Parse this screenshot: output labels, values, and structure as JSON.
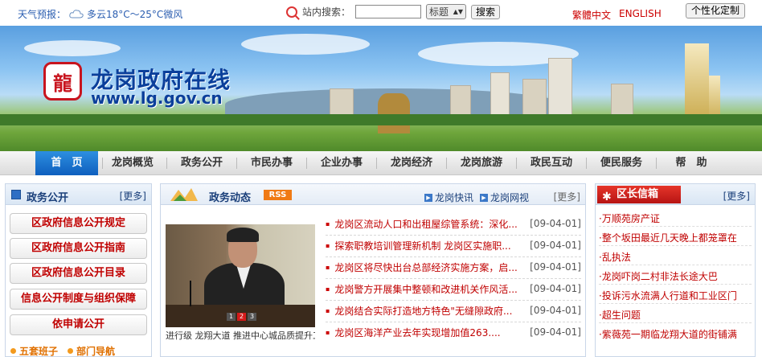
{
  "topbar": {
    "weather_label": "天气预报：",
    "weather_value": "多云18°C～25°C微风",
    "search_label": "站内搜索：",
    "search_value": "",
    "search_scope": "标题",
    "search_button": "搜索",
    "lang_traditional": "繁體中文",
    "lang_english": "ENGLISH",
    "customize_button": "个性化定制"
  },
  "banner": {
    "logo_char": "龍",
    "title": "龙岗政府在线",
    "url": "www.lg.gov.cn"
  },
  "nav": {
    "items": [
      "首　页",
      "龙岗概览",
      "政务公开",
      "市民办事",
      "企业办事",
      "龙岗经济",
      "龙岗旅游",
      "政民互动",
      "便民服务",
      "帮　助"
    ]
  },
  "left": {
    "title": "政务公开",
    "more": "[更多]",
    "buttons": [
      "区政府信息公开规定",
      "区政府信息公开指南",
      "区政府信息公开目录",
      "信息公开制度与组织保障",
      "依申请公开"
    ],
    "footer": [
      "五套班子",
      "部门导航"
    ]
  },
  "middle": {
    "title": "政务动态",
    "rss": "RSS",
    "link1": "龙岗快讯",
    "link2": "龙岗网视",
    "more": "[更多]",
    "photo_caption": "进行级 龙翔大道 推进中心城品质提升工",
    "photo_pages": [
      "1",
      "2",
      "3"
    ],
    "news": [
      {
        "title": "龙岗区流动人口和出租屋综管系统：深化...",
        "date": "[09-04-01]"
      },
      {
        "title": "探索职教培训管理新机制 龙岗区实施职...",
        "date": "[09-04-01]"
      },
      {
        "title": "龙岗区将尽快出台总部经济实施方案，启...",
        "date": "[09-04-01]"
      },
      {
        "title": "龙岗警方开展集中整顿和改进机关作风活...",
        "date": "[09-04-01]"
      },
      {
        "title": "龙岗结合实际打造地方特色\"无缝隙政府...",
        "date": "[09-04-01]"
      },
      {
        "title": "龙岗区海洋产业去年实现增加值263....",
        "date": "[09-04-01]"
      }
    ]
  },
  "right": {
    "title": "区长信箱",
    "more": "[更多]",
    "items": [
      "·万顺苑房产证",
      "·整个坂田最近几天晚上都笼罩在",
      "·乱执法",
      "·龙岗吓岗二村非法长途大巴",
      "·投诉污水流满人行道和工业区门",
      "·超生问题",
      "·紫薇苑一期临龙翔大道的街铺满"
    ]
  },
  "colors": {
    "accent_blue": "#0e5fbe",
    "title_red": "#c00000",
    "header_blue": "#1a3f7a"
  }
}
